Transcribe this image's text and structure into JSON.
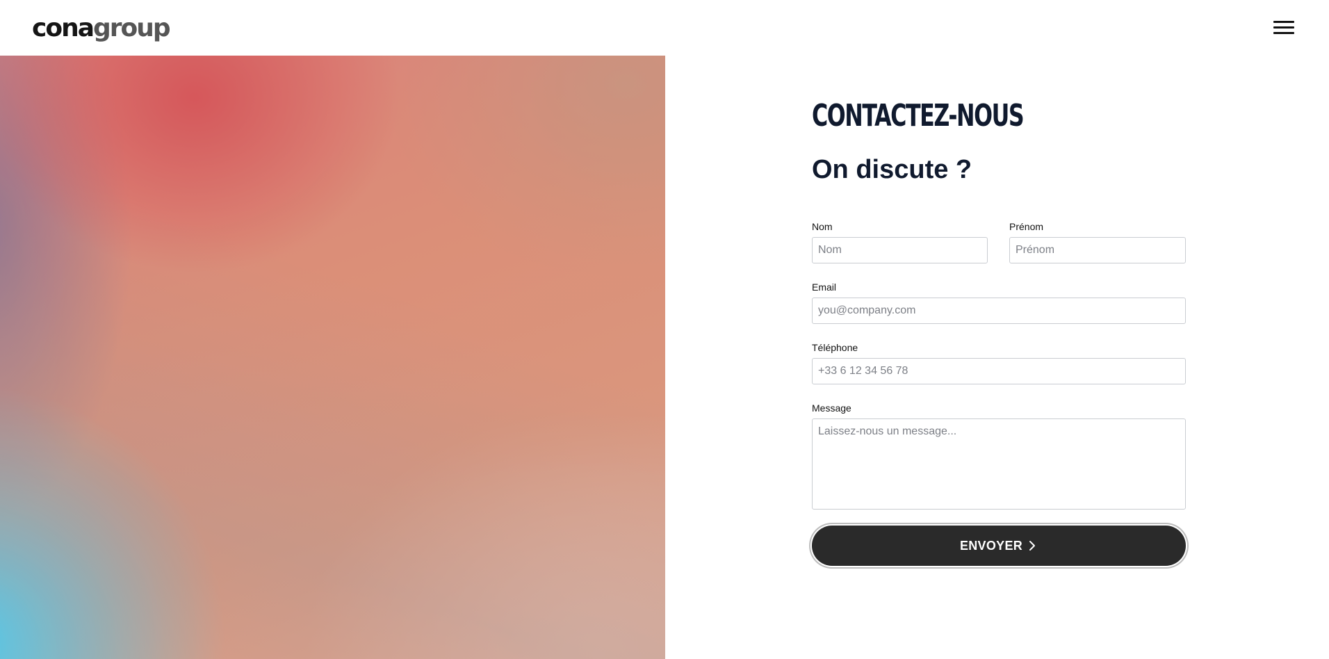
{
  "header": {
    "logo_part1": "cona",
    "logo_part2": "group",
    "menu_icon": "hamburger-menu-icon"
  },
  "hero": {
    "image": "abstract gradient background (red, peach, blue)"
  },
  "contact": {
    "title": "CONTACTEZ-NOUS",
    "subtitle": "On discute ?",
    "fields": {
      "nom": {
        "label": "Nom",
        "placeholder": "Nom",
        "value": ""
      },
      "prenom": {
        "label": "Prénom",
        "placeholder": "Prénom",
        "value": ""
      },
      "email": {
        "label": "Email",
        "placeholder": "you@company.com",
        "value": ""
      },
      "telephone": {
        "label": "Téléphone",
        "placeholder": "+33 6 12 34 56 78",
        "value": ""
      },
      "message": {
        "label": "Message",
        "placeholder": "Laissez-nous un message...",
        "value": ""
      }
    },
    "submit_label": "ENVOYER",
    "submit_icon": "chevron-right-icon"
  },
  "colors": {
    "text_dark": "#101a2e",
    "button_bg": "#2a2a2a",
    "button_text": "#ffffff",
    "input_border": "#c9ccd1"
  }
}
